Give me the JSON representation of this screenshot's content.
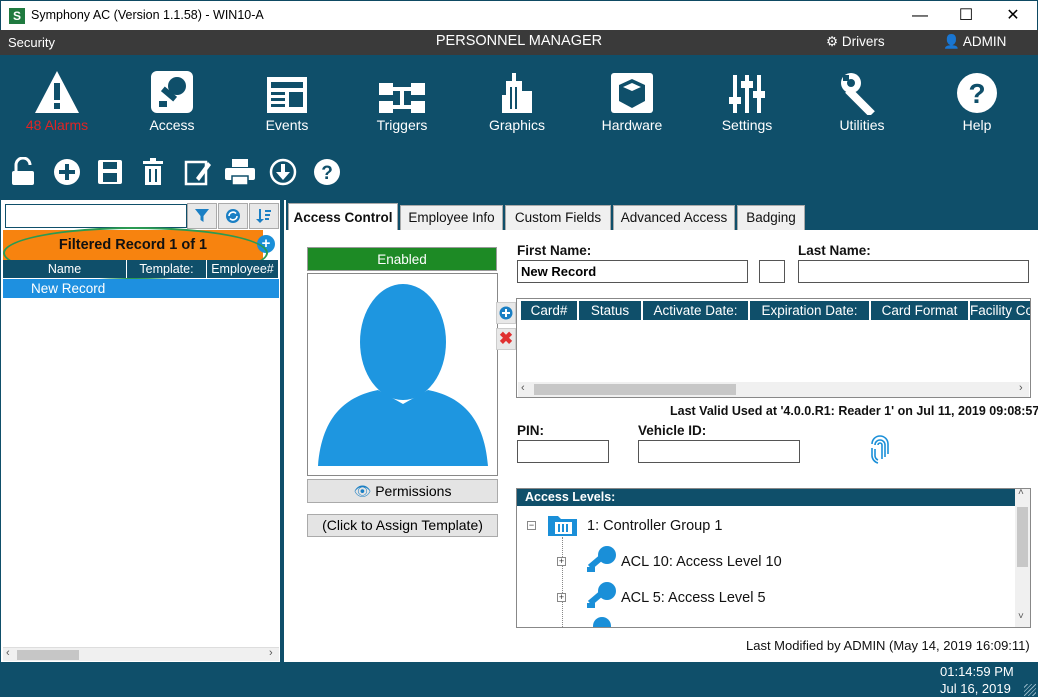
{
  "window": {
    "app_icon": "S",
    "title": "Symphony AC  (Version 1.1.58) - WIN10-A",
    "minimize": "—",
    "maximize": "☐",
    "close": "✕"
  },
  "header": {
    "security": "Security",
    "module_title": "PERSONNEL MANAGER",
    "drivers": "Drivers",
    "user": "ADMIN"
  },
  "nav": [
    {
      "label": "48 Alarms",
      "icon": "alarm-warning-icon"
    },
    {
      "label": "Access",
      "icon": "access-key-icon"
    },
    {
      "label": "Events",
      "icon": "events-newspaper-icon"
    },
    {
      "label": "Triggers",
      "icon": "triggers-flow-icon"
    },
    {
      "label": "Graphics",
      "icon": "graphics-building-icon"
    },
    {
      "label": "Hardware",
      "icon": "hardware-box-icon"
    },
    {
      "label": "Settings",
      "icon": "settings-sliders-icon"
    },
    {
      "label": "Utilities",
      "icon": "utilities-wrench-icon"
    },
    {
      "label": "Help",
      "icon": "help-question-icon"
    }
  ],
  "toolbar_icons": [
    "lock-icon",
    "add-icon",
    "save-icon",
    "delete-icon",
    "edit-icon",
    "print-icon",
    "download-icon",
    "help-icon"
  ],
  "left_panel": {
    "search_value": "",
    "filter_banner": "Filtered Record 1 of 1",
    "columns": [
      "Name",
      "Template:",
      "Employee#"
    ],
    "rows": [
      {
        "name": "New Record"
      }
    ]
  },
  "tabs": [
    "Access Control",
    "Employee Info",
    "Custom Fields",
    "Advanced Access",
    "Badging"
  ],
  "record": {
    "status": "Enabled",
    "first_name_label": "First Name:",
    "first_name": "New Record",
    "middle_initial": "",
    "last_name_label": "Last Name:",
    "last_name": "",
    "permissions": "Permissions",
    "assign_template": "(Click to Assign Template)",
    "card_columns": [
      "Card#",
      "Status",
      "Activate Date:",
      "Expiration Date:",
      "Card Format",
      "Facility Code"
    ],
    "last_valid": "Last Valid Used at '4.0.0.R1: Reader 1' on Jul 11, 2019  09:08:57",
    "pin_label": "PIN:",
    "pin": "",
    "vehicle_label": "Vehicle ID:",
    "vehicle": "",
    "access_levels_label": "Access Levels:",
    "tree": {
      "group": "1:  Controller Group 1",
      "levels": [
        "ACL 10:  Access Level 10",
        "ACL 5:  Access Level 5"
      ]
    },
    "last_modified": "Last Modified by ADMIN (May 14, 2019  16:09:11)"
  },
  "status_bar": {
    "time": "01:14:59 PM",
    "date": "Jul 16, 2019"
  },
  "colors": {
    "nav_bg": "#0f4f6a",
    "top_bar": "#3a3a3a",
    "filter_banner": "#f7830f",
    "enabled": "#1d8a25",
    "selection": "#1e90e0",
    "alarm_text": "#e02424"
  }
}
